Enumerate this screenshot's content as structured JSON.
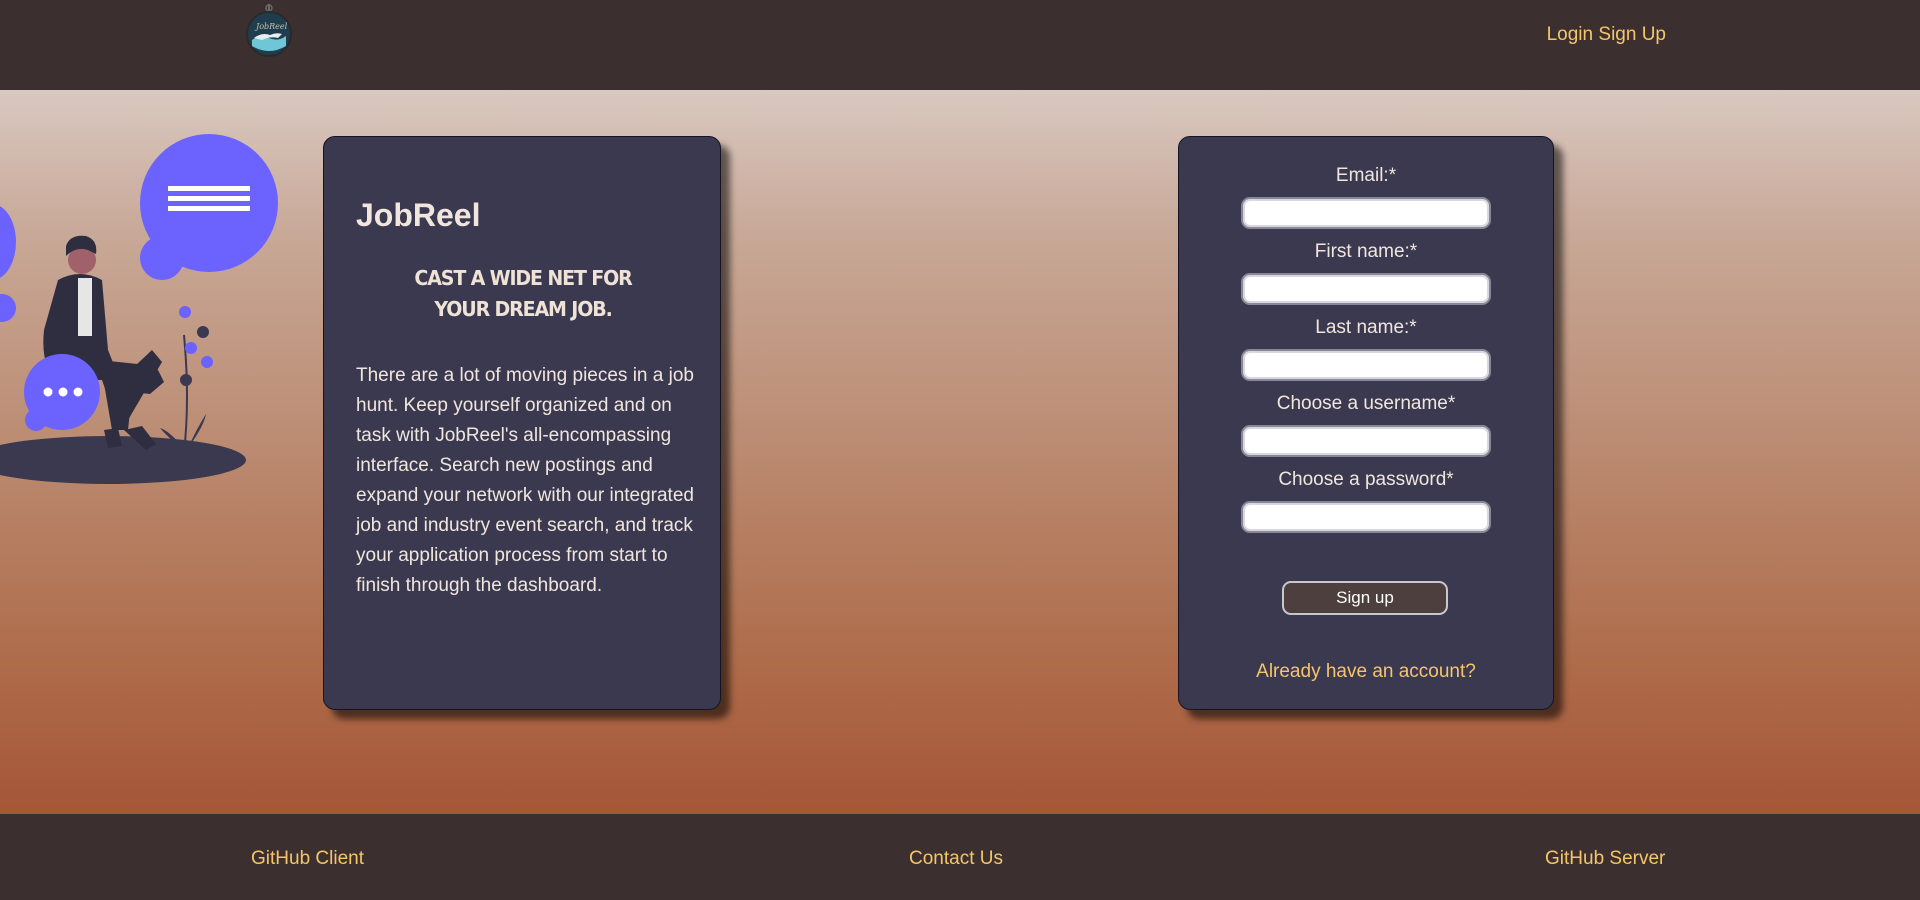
{
  "header": {
    "logo_text": "JobReel",
    "nav": {
      "login": "Login",
      "signup": "Sign Up"
    }
  },
  "info_card": {
    "brand": "JobReel",
    "tagline": "CAST A WIDE NET FOR YOUR DREAM JOB.",
    "description": "There are a lot of moving pieces in a job hunt. Keep yourself organized and on task with JobReel's all-encompassing interface. Search new postings and expand your network with our integrated job and industry event search, and track your application process from start to finish through the dashboard."
  },
  "signup_form": {
    "fields": [
      {
        "label": "Email:*",
        "value": ""
      },
      {
        "label": "First name:*",
        "value": ""
      },
      {
        "label": "Last name:*",
        "value": ""
      },
      {
        "label": "Choose a username*",
        "value": ""
      },
      {
        "label": "Choose a password*",
        "value": ""
      }
    ],
    "submit_label": "Sign up",
    "login_link": "Already have an account?"
  },
  "footer": {
    "github_client": "GitHub Client",
    "contact": "Contact Us",
    "github_server": "GitHub Server"
  },
  "colors": {
    "header_bg": "#3b302f",
    "card_bg": "#3b3950",
    "accent_link": "#f6c569",
    "illustration_purple": "#6c63ff"
  },
  "icons": [
    "jobreel-logo-icon",
    "person-with-chat-bubbles-illustration"
  ]
}
